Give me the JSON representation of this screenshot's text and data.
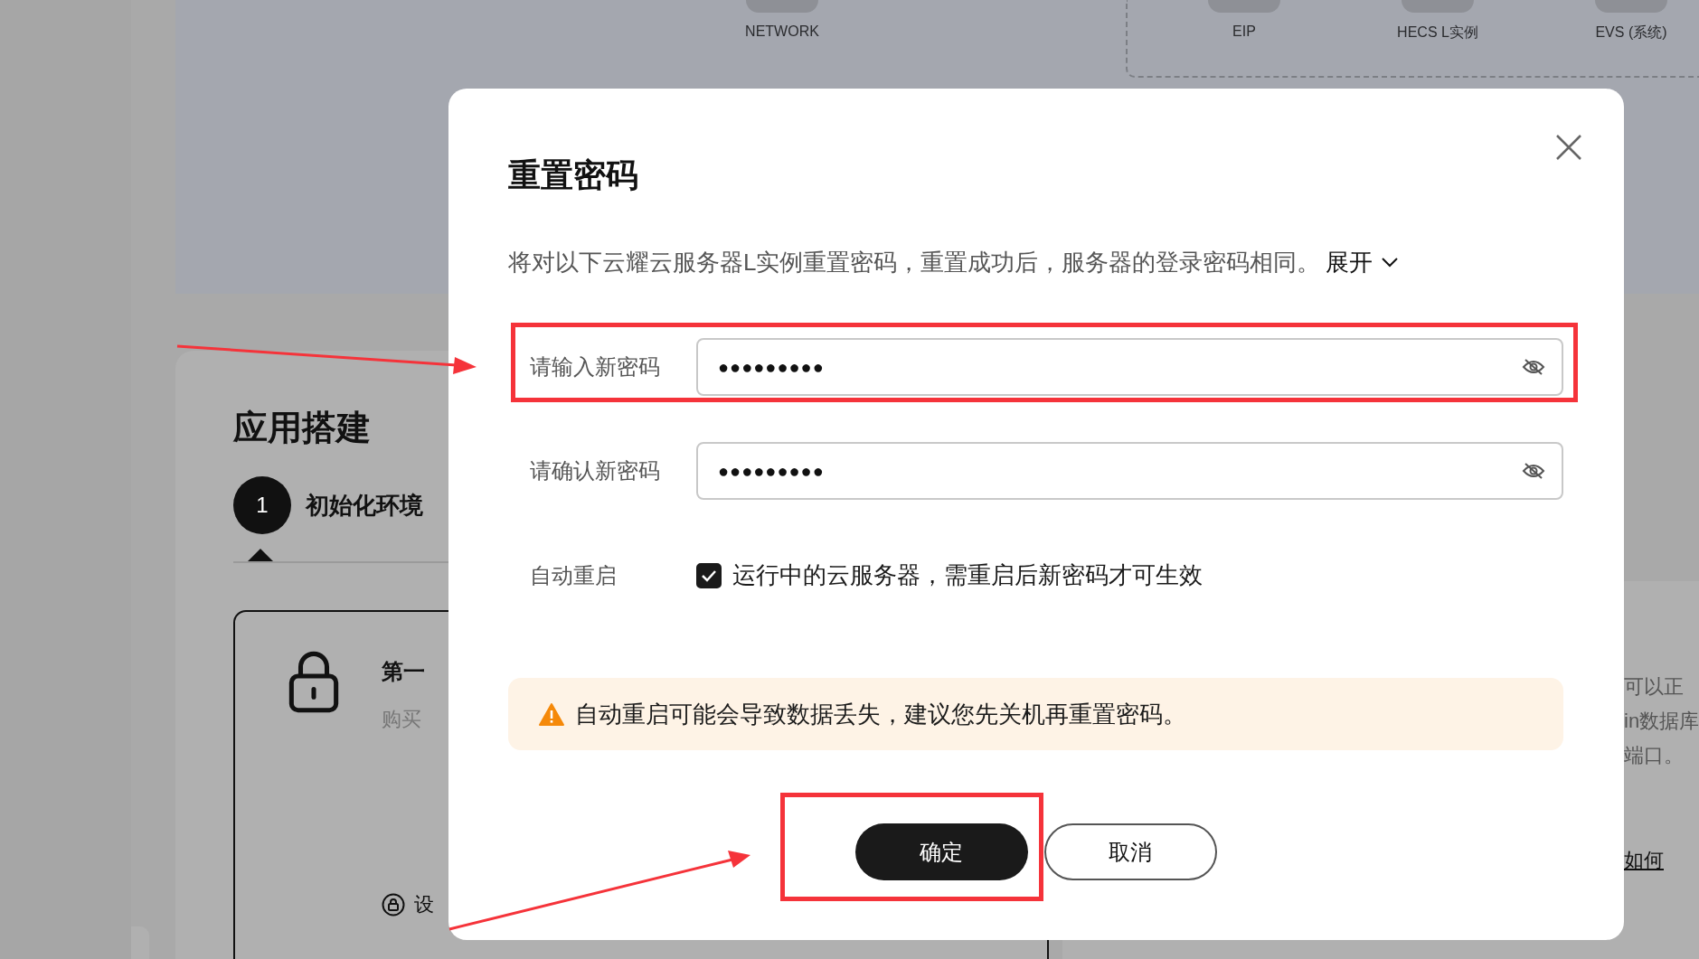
{
  "background": {
    "topology": {
      "items": [
        {
          "label": "NETWORK"
        },
        {
          "label": "EIP"
        },
        {
          "label": "HECS L实例"
        },
        {
          "label": "EVS (系统)"
        }
      ]
    },
    "app_build": {
      "title": "应用搭建",
      "steps": [
        {
          "number": "1",
          "label": "初始化环境"
        }
      ],
      "card": {
        "title": "第一",
        "description": "购买",
        "link": "设"
      }
    },
    "right_panel": {
      "lines": [
        "可以正",
        "in数据库",
        "端口。"
      ],
      "link": "如何"
    }
  },
  "dialog": {
    "title": "重置密码",
    "description": "将对以下云耀云服务器L实例重置密码，重置成功后，服务器的登录密码相同。",
    "expand_link": "展开",
    "fields": [
      {
        "label": "请输入新密码",
        "value": "●●●●●●●●●"
      },
      {
        "label": "请确认新密码",
        "value": "●●●●●●●●●"
      }
    ],
    "auto_restart": {
      "label": "自动重启",
      "checked": true,
      "text": "运行中的云服务器，需重启后新密码才可生效"
    },
    "warning": "自动重启可能会导致数据丢失，建议您先关机再重置密码。",
    "buttons": [
      {
        "label": "确定",
        "kind": "primary"
      },
      {
        "label": "取消",
        "kind": "secondary"
      }
    ]
  }
}
